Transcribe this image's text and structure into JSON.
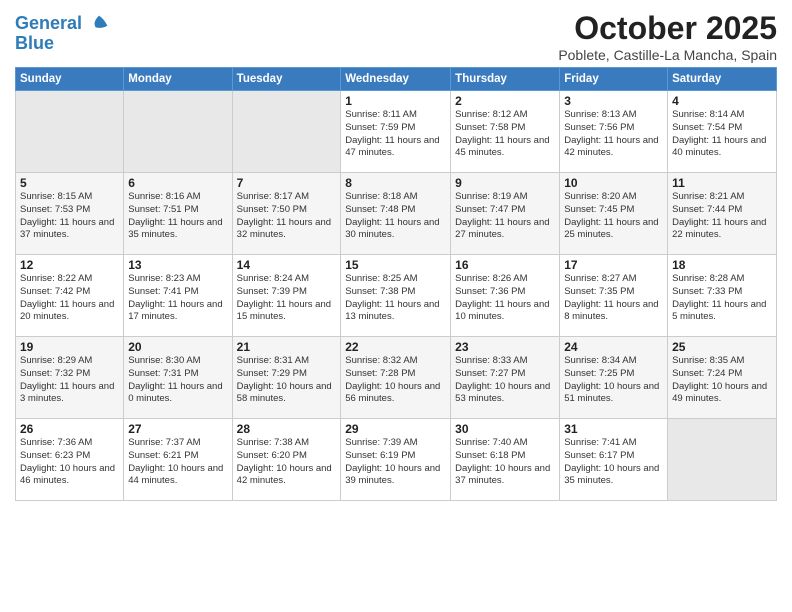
{
  "header": {
    "logo_line1": "General",
    "logo_line2": "Blue",
    "month_title": "October 2025",
    "location": "Poblete, Castille-La Mancha, Spain"
  },
  "days_of_week": [
    "Sunday",
    "Monday",
    "Tuesday",
    "Wednesday",
    "Thursday",
    "Friday",
    "Saturday"
  ],
  "weeks": [
    [
      {
        "day": "",
        "info": ""
      },
      {
        "day": "",
        "info": ""
      },
      {
        "day": "",
        "info": ""
      },
      {
        "day": "1",
        "info": "Sunrise: 8:11 AM\nSunset: 7:59 PM\nDaylight: 11 hours\nand 47 minutes."
      },
      {
        "day": "2",
        "info": "Sunrise: 8:12 AM\nSunset: 7:58 PM\nDaylight: 11 hours\nand 45 minutes."
      },
      {
        "day": "3",
        "info": "Sunrise: 8:13 AM\nSunset: 7:56 PM\nDaylight: 11 hours\nand 42 minutes."
      },
      {
        "day": "4",
        "info": "Sunrise: 8:14 AM\nSunset: 7:54 PM\nDaylight: 11 hours\nand 40 minutes."
      }
    ],
    [
      {
        "day": "5",
        "info": "Sunrise: 8:15 AM\nSunset: 7:53 PM\nDaylight: 11 hours\nand 37 minutes."
      },
      {
        "day": "6",
        "info": "Sunrise: 8:16 AM\nSunset: 7:51 PM\nDaylight: 11 hours\nand 35 minutes."
      },
      {
        "day": "7",
        "info": "Sunrise: 8:17 AM\nSunset: 7:50 PM\nDaylight: 11 hours\nand 32 minutes."
      },
      {
        "day": "8",
        "info": "Sunrise: 8:18 AM\nSunset: 7:48 PM\nDaylight: 11 hours\nand 30 minutes."
      },
      {
        "day": "9",
        "info": "Sunrise: 8:19 AM\nSunset: 7:47 PM\nDaylight: 11 hours\nand 27 minutes."
      },
      {
        "day": "10",
        "info": "Sunrise: 8:20 AM\nSunset: 7:45 PM\nDaylight: 11 hours\nand 25 minutes."
      },
      {
        "day": "11",
        "info": "Sunrise: 8:21 AM\nSunset: 7:44 PM\nDaylight: 11 hours\nand 22 minutes."
      }
    ],
    [
      {
        "day": "12",
        "info": "Sunrise: 8:22 AM\nSunset: 7:42 PM\nDaylight: 11 hours\nand 20 minutes."
      },
      {
        "day": "13",
        "info": "Sunrise: 8:23 AM\nSunset: 7:41 PM\nDaylight: 11 hours\nand 17 minutes."
      },
      {
        "day": "14",
        "info": "Sunrise: 8:24 AM\nSunset: 7:39 PM\nDaylight: 11 hours\nand 15 minutes."
      },
      {
        "day": "15",
        "info": "Sunrise: 8:25 AM\nSunset: 7:38 PM\nDaylight: 11 hours\nand 13 minutes."
      },
      {
        "day": "16",
        "info": "Sunrise: 8:26 AM\nSunset: 7:36 PM\nDaylight: 11 hours\nand 10 minutes."
      },
      {
        "day": "17",
        "info": "Sunrise: 8:27 AM\nSunset: 7:35 PM\nDaylight: 11 hours\nand 8 minutes."
      },
      {
        "day": "18",
        "info": "Sunrise: 8:28 AM\nSunset: 7:33 PM\nDaylight: 11 hours\nand 5 minutes."
      }
    ],
    [
      {
        "day": "19",
        "info": "Sunrise: 8:29 AM\nSunset: 7:32 PM\nDaylight: 11 hours\nand 3 minutes."
      },
      {
        "day": "20",
        "info": "Sunrise: 8:30 AM\nSunset: 7:31 PM\nDaylight: 11 hours\nand 0 minutes."
      },
      {
        "day": "21",
        "info": "Sunrise: 8:31 AM\nSunset: 7:29 PM\nDaylight: 10 hours\nand 58 minutes."
      },
      {
        "day": "22",
        "info": "Sunrise: 8:32 AM\nSunset: 7:28 PM\nDaylight: 10 hours\nand 56 minutes."
      },
      {
        "day": "23",
        "info": "Sunrise: 8:33 AM\nSunset: 7:27 PM\nDaylight: 10 hours\nand 53 minutes."
      },
      {
        "day": "24",
        "info": "Sunrise: 8:34 AM\nSunset: 7:25 PM\nDaylight: 10 hours\nand 51 minutes."
      },
      {
        "day": "25",
        "info": "Sunrise: 8:35 AM\nSunset: 7:24 PM\nDaylight: 10 hours\nand 49 minutes."
      }
    ],
    [
      {
        "day": "26",
        "info": "Sunrise: 7:36 AM\nSunset: 6:23 PM\nDaylight: 10 hours\nand 46 minutes."
      },
      {
        "day": "27",
        "info": "Sunrise: 7:37 AM\nSunset: 6:21 PM\nDaylight: 10 hours\nand 44 minutes."
      },
      {
        "day": "28",
        "info": "Sunrise: 7:38 AM\nSunset: 6:20 PM\nDaylight: 10 hours\nand 42 minutes."
      },
      {
        "day": "29",
        "info": "Sunrise: 7:39 AM\nSunset: 6:19 PM\nDaylight: 10 hours\nand 39 minutes."
      },
      {
        "day": "30",
        "info": "Sunrise: 7:40 AM\nSunset: 6:18 PM\nDaylight: 10 hours\nand 37 minutes."
      },
      {
        "day": "31",
        "info": "Sunrise: 7:41 AM\nSunset: 6:17 PM\nDaylight: 10 hours\nand 35 minutes."
      },
      {
        "day": "",
        "info": ""
      }
    ]
  ]
}
